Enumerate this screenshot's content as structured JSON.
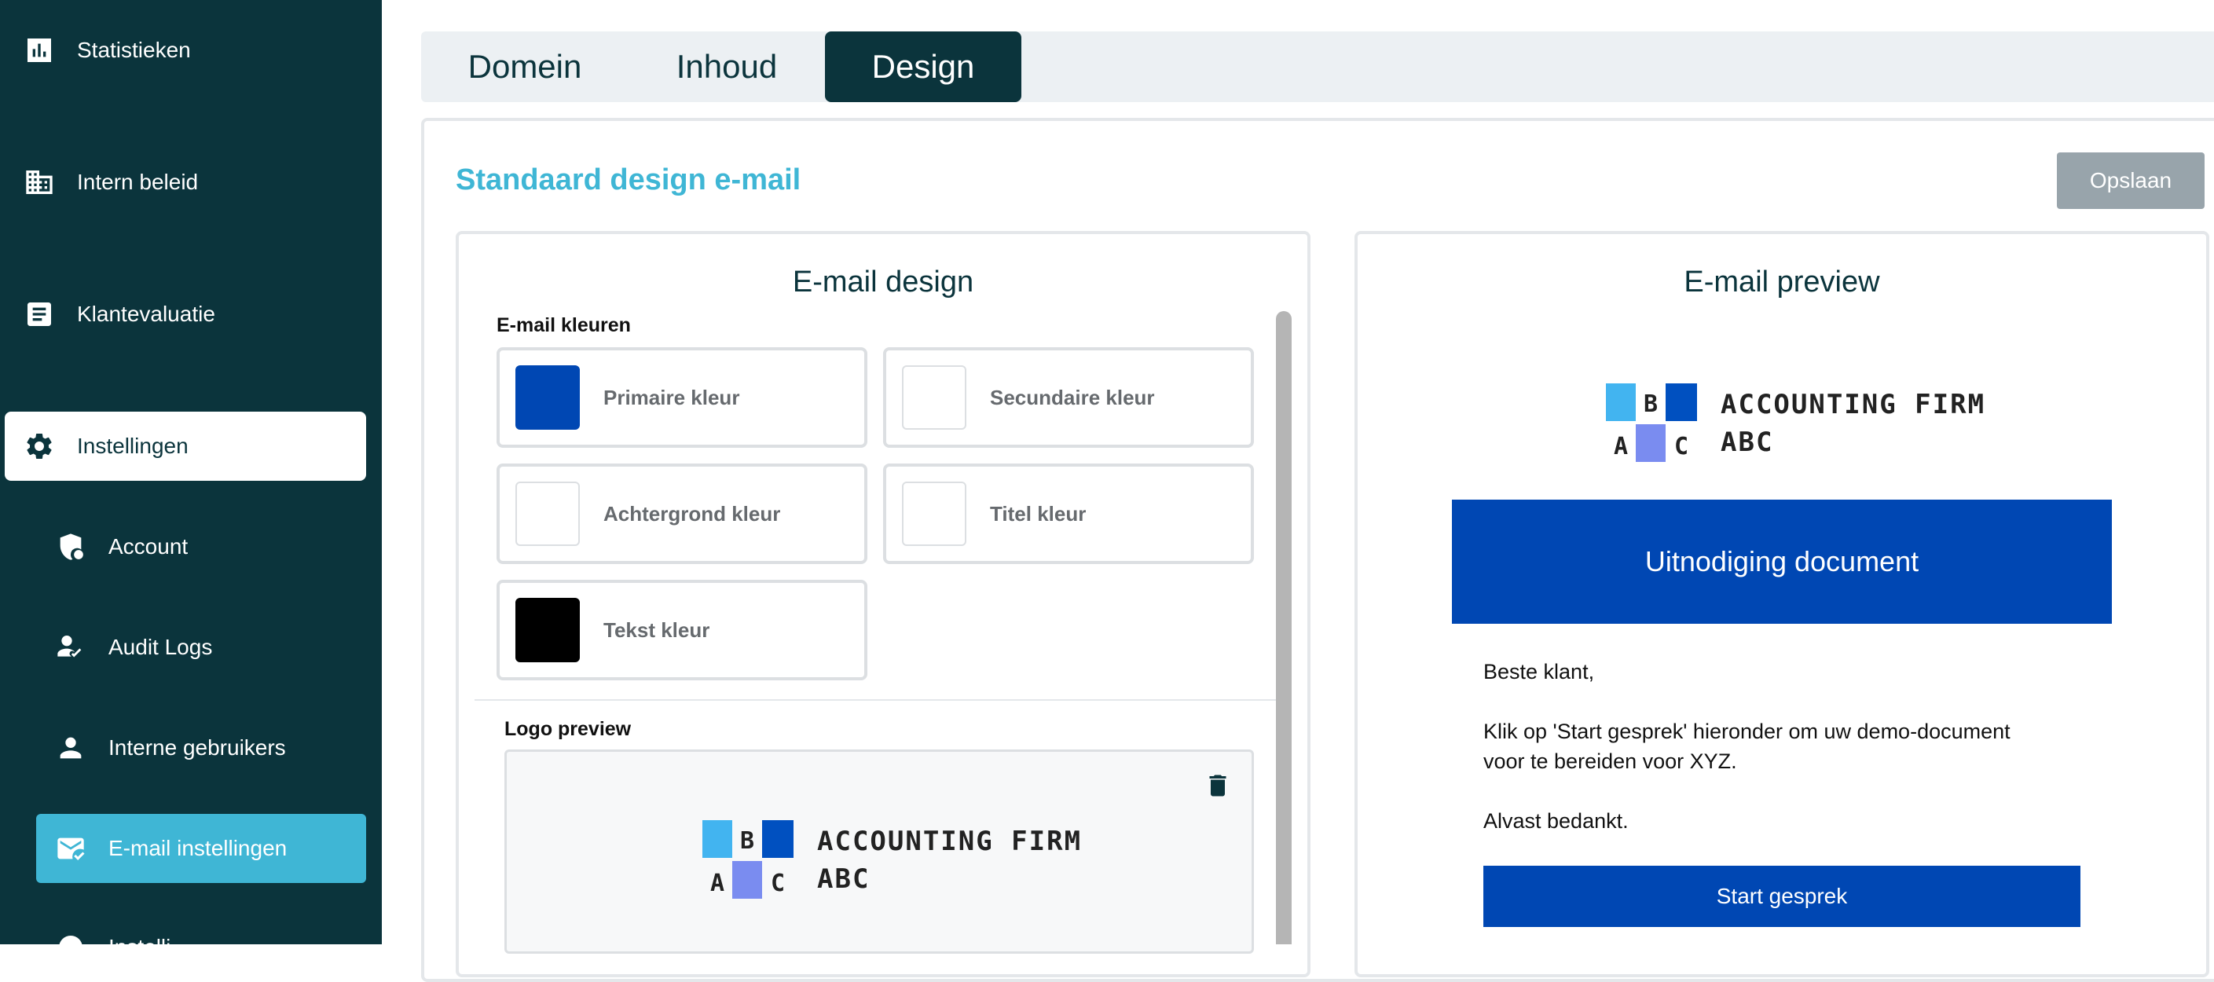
{
  "sidebar": {
    "items": [
      {
        "label": "Statistieken",
        "icon": "bar-chart-icon"
      },
      {
        "label": "Intern beleid",
        "icon": "building-icon"
      },
      {
        "label": "Klantevaluatie",
        "icon": "document-icon"
      },
      {
        "label": "Instellingen",
        "icon": "gear-icon"
      }
    ],
    "sub_items": [
      {
        "label": "Account",
        "icon": "shield-account-icon"
      },
      {
        "label": "Audit Logs",
        "icon": "user-check-icon"
      },
      {
        "label": "Interne gebruikers",
        "icon": "user-icon"
      },
      {
        "label": "E-mail instellingen",
        "icon": "mail-check-icon"
      }
    ],
    "partial_item": "Instelli"
  },
  "tabs": [
    {
      "label": "Domein"
    },
    {
      "label": "Inhoud"
    },
    {
      "label": "Design"
    }
  ],
  "active_tab": "Design",
  "main": {
    "section_title": "Standaard design e-mail",
    "save_label": "Opslaan"
  },
  "design_panel": {
    "title": "E-mail design",
    "colors_label": "E-mail kleuren",
    "colors": [
      {
        "label": "Primaire kleur",
        "color": "#0047b3"
      },
      {
        "label": "Secundaire kleur",
        "color": "#ffffff"
      },
      {
        "label": "Achtergrond kleur",
        "color": "#ffffff"
      },
      {
        "label": "Titel kleur",
        "color": "#ffffff"
      },
      {
        "label": "Tekst kleur",
        "color": "#000000"
      }
    ],
    "logo_label": "Logo preview"
  },
  "logo": {
    "letters": [
      "B",
      "A",
      "C"
    ],
    "line1": "ACCOUNTING FIRM",
    "line2": "ABC"
  },
  "preview_panel": {
    "title": "E-mail preview",
    "banner": "Uitnodiging document",
    "greeting": "Beste klant,",
    "body_line1": "Klik op 'Start gesprek' hieronder om uw demo-document",
    "body_line2": "voor te bereiden voor XYZ.",
    "closing": "Alvast bedankt.",
    "button": "Start gesprek"
  },
  "colors": {
    "sidebar_bg": "#0b343c",
    "accent": "#3fb6d5",
    "primary": "#0047b3"
  }
}
